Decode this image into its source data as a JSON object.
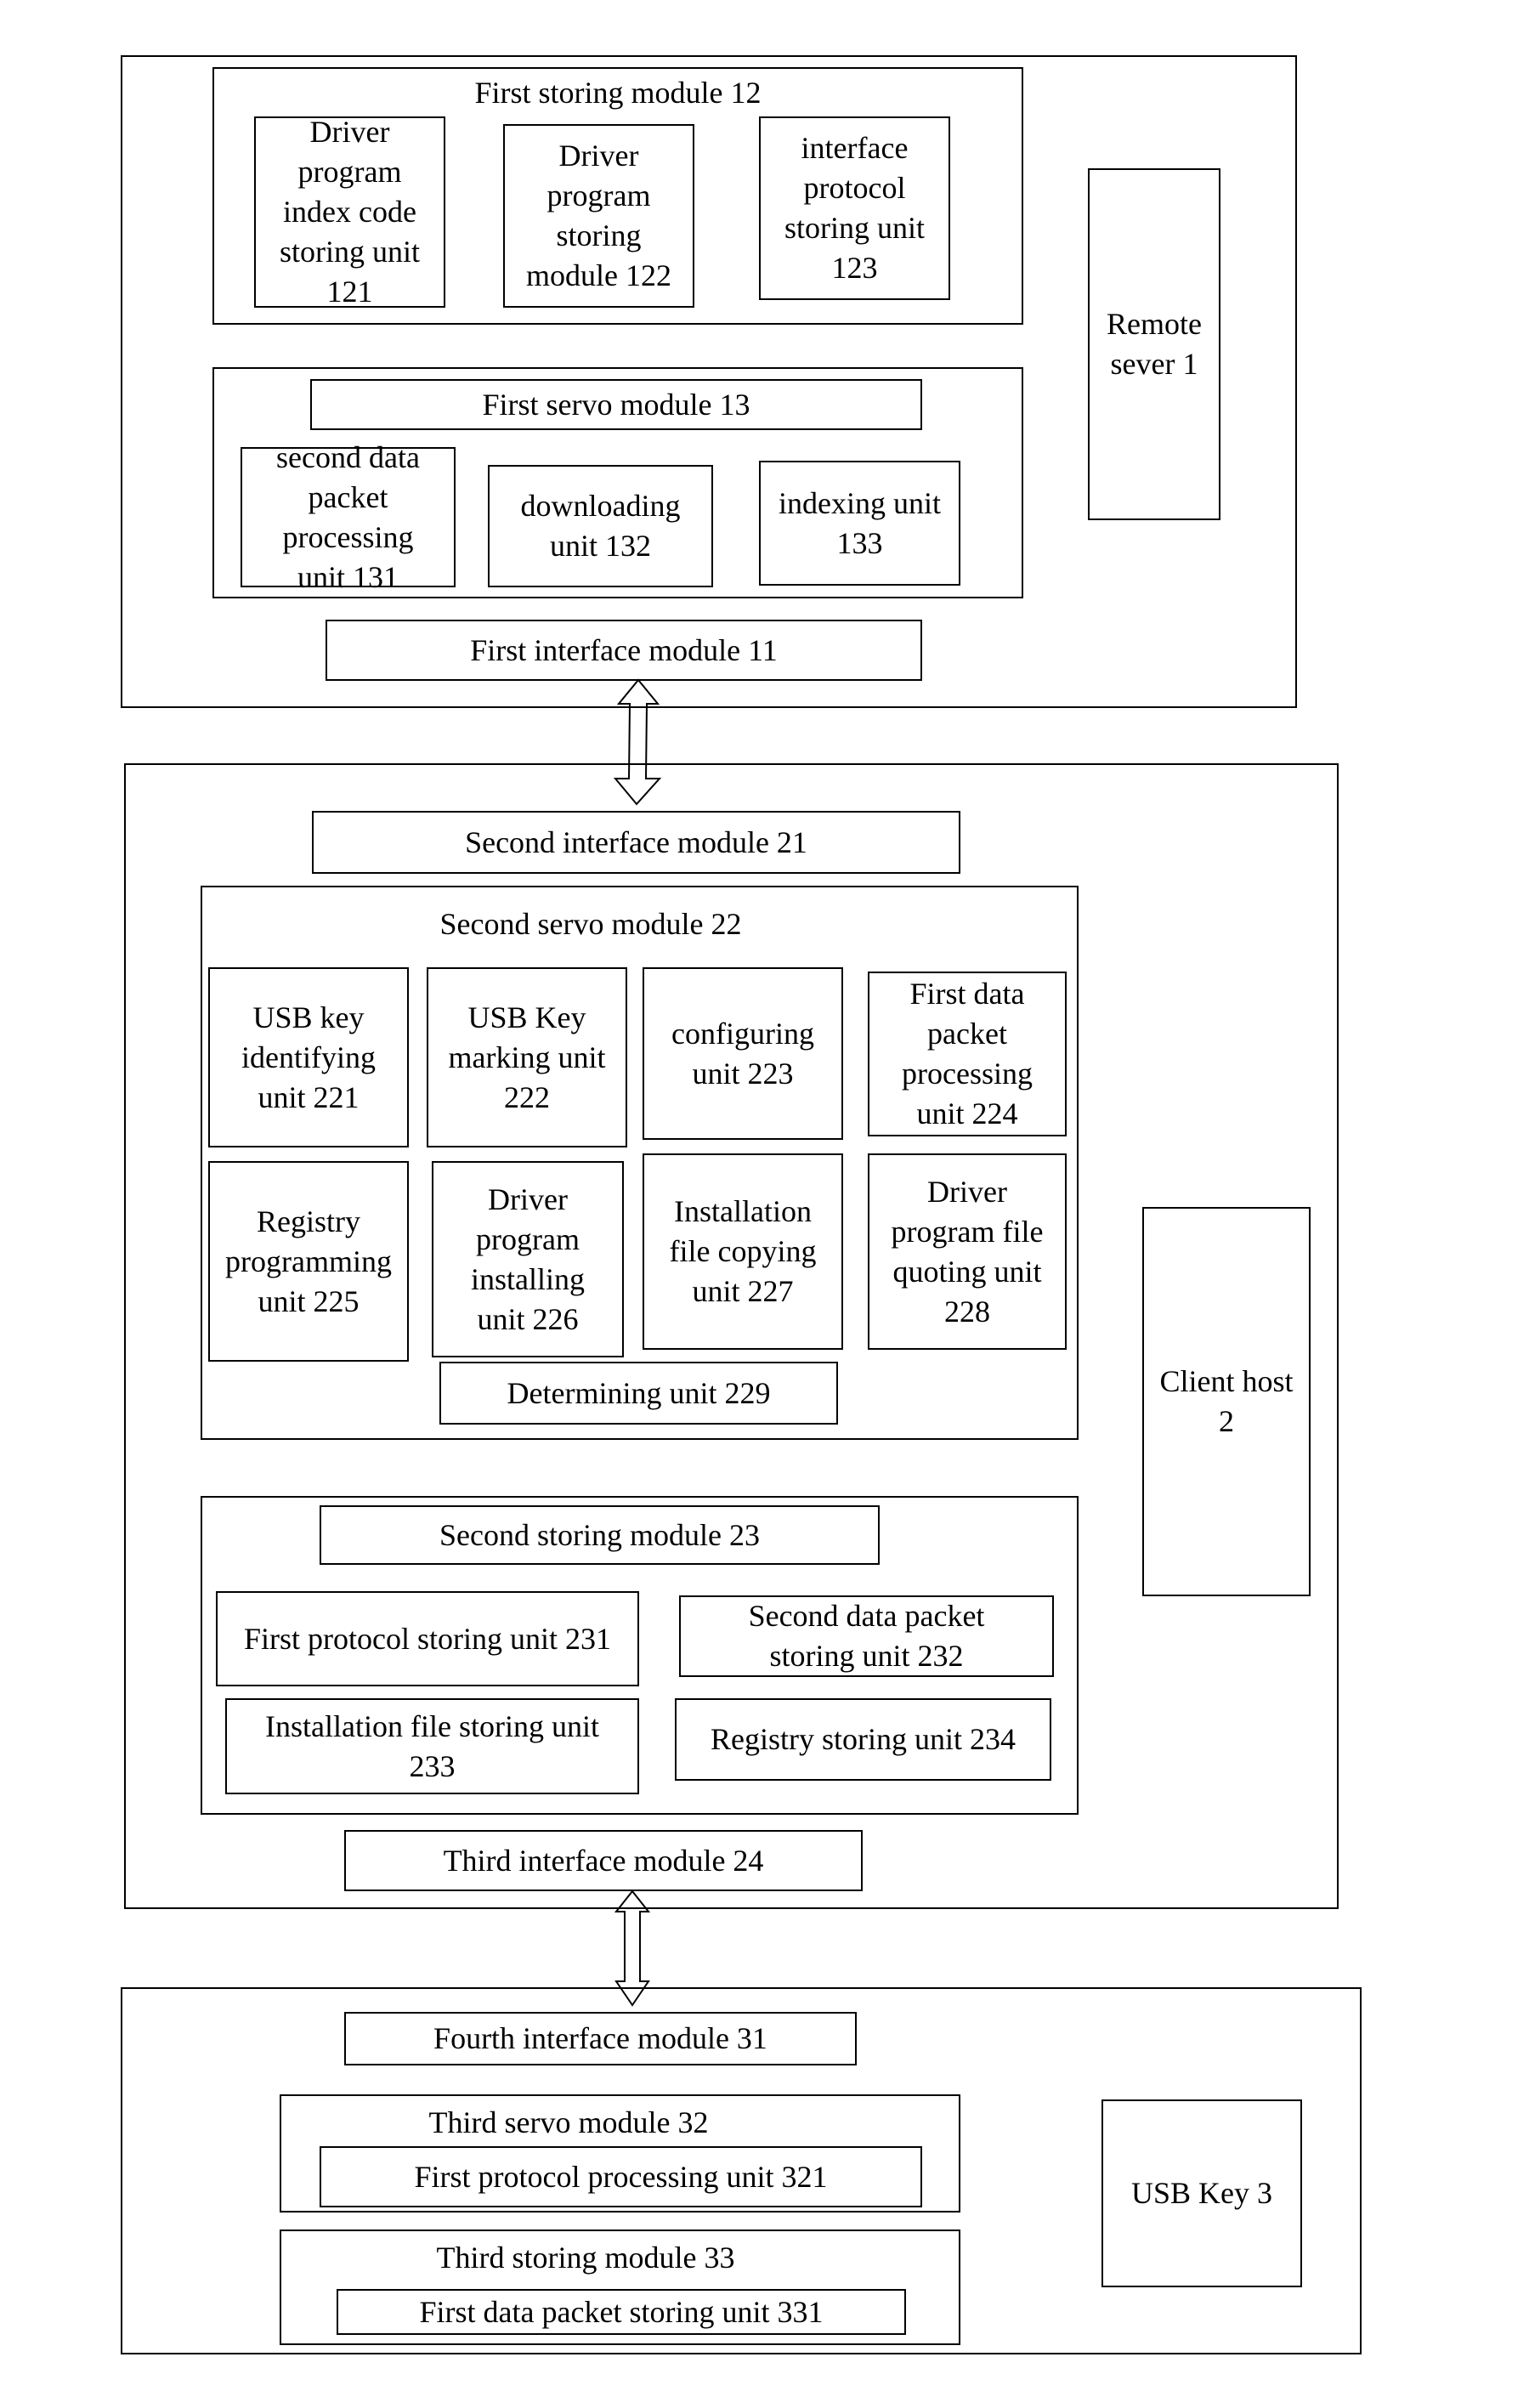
{
  "remote_server": {
    "label": "Remote sever 1",
    "first_storing_module": {
      "title": "First storing module 12",
      "units": [
        "Driver program index code storing unit 121",
        "Driver program storing module 122",
        "interface protocol storing unit 123"
      ]
    },
    "first_servo_module": {
      "title": "First servo module 13",
      "units": [
        "second data packet processing unit 131",
        "downloading unit 132",
        "indexing unit 133"
      ]
    },
    "first_interface_module": "First interface module 11"
  },
  "client_host": {
    "label": "Client host 2",
    "second_interface_module": "Second interface module 21",
    "second_servo_module": {
      "title": "Second servo module 22",
      "units": [
        "USB key identifying unit 221",
        "USB Key marking unit 222",
        "configuring unit 223",
        "First data packet processing unit 224",
        "Registry programming unit 225",
        "Driver program installing unit 226",
        "Installation file copying unit 227",
        "Driver program file quoting unit 228",
        "Determining unit 229"
      ]
    },
    "second_storing_module": {
      "title": "Second storing module 23",
      "units": [
        "First protocol storing unit 231",
        "Second data packet storing unit 232",
        "Installation file storing unit 233",
        "Registry storing unit 234"
      ]
    },
    "third_interface_module": "Third interface module 24"
  },
  "usb_key": {
    "label": "USB Key 3",
    "fourth_interface_module": "Fourth interface module 31",
    "third_servo_module": {
      "title": "Third servo module 32",
      "units": [
        "First protocol processing unit 321"
      ]
    },
    "third_storing_module": {
      "title": "Third storing module 33",
      "units": [
        "First data packet storing unit 331"
      ]
    }
  },
  "connections": [
    {
      "from": "First interface module 11",
      "to": "Second interface module 21",
      "type": "bidirectional"
    },
    {
      "from": "Third interface module 24",
      "to": "Fourth interface module 31",
      "type": "bidirectional"
    }
  ]
}
